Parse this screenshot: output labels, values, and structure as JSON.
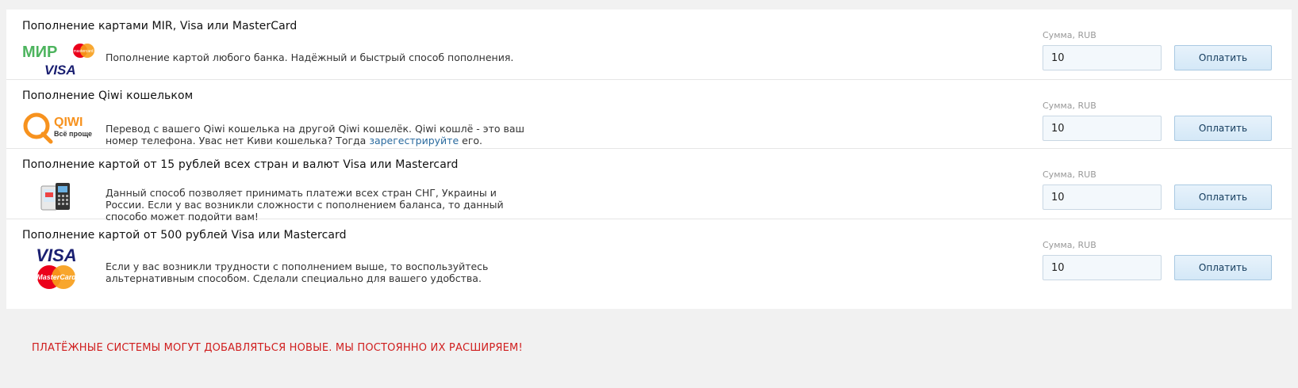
{
  "amount_label": "Сумма, RUB",
  "pay_label": "Оплатить",
  "methods": [
    {
      "title": "Пополнение картами MIR, Visa или MasterCard",
      "description": "Пополнение картой любого банка. Надёжный и быстрый способ пополнения.",
      "amount": "10",
      "logo": "mir-visa-mastercard-logo",
      "logo_text": {
        "mir": "МИР",
        "visa": "VISA",
        "mc": "mastercard"
      }
    },
    {
      "title": "Пополнение Qiwi кошельком",
      "description": "Перевод с вашего Qiwi кошелька на другой Qiwi кошелёк. Qiwi кошлё - это ваш номер телефона. Увас нет Киви кошелька? Тогда ",
      "link_text": "зарегестрируйте",
      "description_end": " его.",
      "amount": "10",
      "logo": "qiwi-logo",
      "logo_text": {
        "qiwi": "QIWI",
        "slogan": "Всё проще"
      }
    },
    {
      "title": "Пополнение картой от 15 рублей всех стран и валют Visa или Mastercard",
      "description": "Данный способ позволяет принимать платежи всех стран СНГ, Украины и России. Если у вас возникли сложности с пополнением баланса, то данный способо может подойти вам!",
      "amount": "10",
      "logo": "payment-terminal-icon"
    },
    {
      "title": "Пополнение картой от 500 рублей Visa или Mastercard",
      "description": "Если у вас возникли трудности с пополнением выше, то воспользуйтесь альтернативным способом. Сделали специально для вашего удобства.",
      "amount": "10",
      "logo": "visa-mastercard-logo",
      "logo_text": {
        "visa": "VISA",
        "mc": "MasterCard"
      }
    }
  ],
  "notice": "ПЛАТЁЖНЫЕ СИСТЕМЫ МОГУТ ДОБАВЛЯТЬСЯ НОВЫЕ. МЫ ПОСТОЯННО ИХ РАСШИРЯЕМ!",
  "colors": {
    "notice": "#d01e1e",
    "link": "#2a6a9e",
    "mir_green": "#4db45e",
    "qiwi_orange": "#f7921e",
    "visa_blue": "#1a1f71",
    "mc_red": "#eb001b",
    "mc_orange": "#f79e1b"
  }
}
